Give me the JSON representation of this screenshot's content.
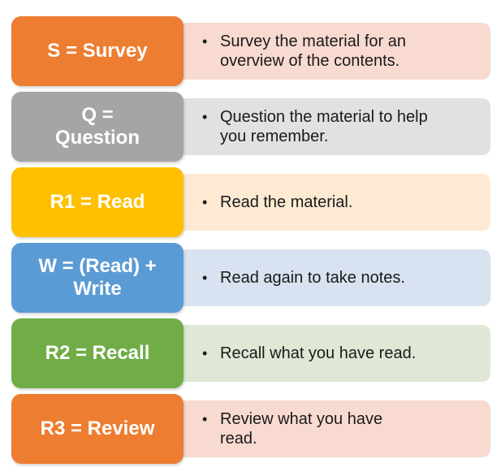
{
  "steps": [
    {
      "label": "S = Survey",
      "description": "Survey the material for an overview of the contents.",
      "label_color": "#ED7D31",
      "desc_color": "#F8DAD1"
    },
    {
      "label": "Q = Question",
      "description": "Question the material to help you remember.",
      "label_color": "#A5A5A5",
      "desc_color": "#E1E1E1"
    },
    {
      "label": "R1 = Read",
      "description": "Read the material.",
      "label_color": "#FFC000",
      "desc_color": "#FEEAD3"
    },
    {
      "label": "W = (Read) + Write",
      "description": "Read again to take notes.",
      "label_color": "#5B9BD5",
      "desc_color": "#D9E2F0"
    },
    {
      "label": "R2 = Recall",
      "description": "Recall what you have read.",
      "label_color": "#70AD47",
      "desc_color": "#DEE8D5"
    },
    {
      "label": "R3 = Review",
      "description": "Review what you have read.",
      "label_color": "#ED7D31",
      "desc_color": "#F8DAD1"
    }
  ],
  "bullet_char": "•"
}
